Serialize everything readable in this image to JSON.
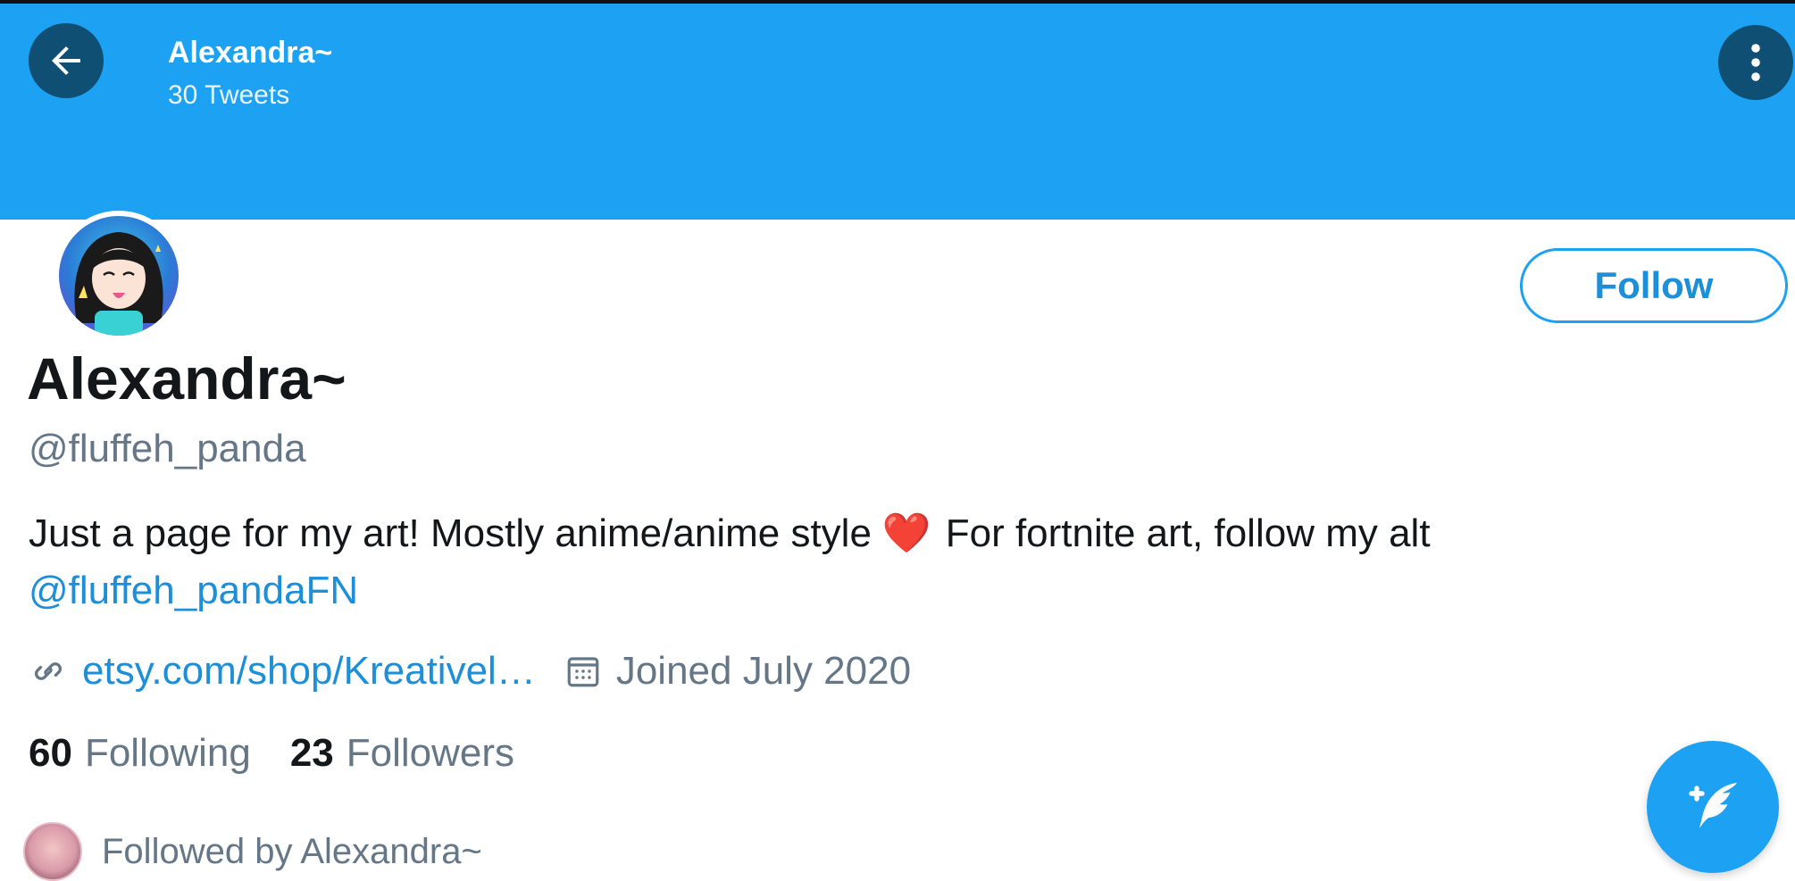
{
  "header": {
    "title": "Alexandra~",
    "tweet_count": "30 Tweets",
    "banner_color": "#1da1f2",
    "back_icon": "arrow-left-icon",
    "more_icon": "vertical-ellipsis-icon"
  },
  "profile": {
    "display_name": "Alexandra~",
    "handle": "@fluffeh_panda",
    "bio_text": "Just a page for my art! Mostly anime/anime style",
    "bio_emoji": "❤️",
    "bio_text_2": "For fortnite art, follow my alt",
    "bio_mention": "@fluffeh_pandaFN",
    "website": "etsy.com/shop/Kreativel…",
    "joined": "Joined July 2020",
    "follow_label": "Follow"
  },
  "stats": {
    "following_count": "60",
    "following_label": "Following",
    "followers_count": "23",
    "followers_label": "Followers"
  },
  "followed_by": {
    "text": "Followed by Alexandra~"
  },
  "fab": {
    "icon": "compose-tweet-icon"
  },
  "colors": {
    "accent": "#1da1f2",
    "link": "#1d8fd8",
    "text_primary": "#14171a",
    "text_secondary": "#657786",
    "heart": "#e0245e"
  }
}
